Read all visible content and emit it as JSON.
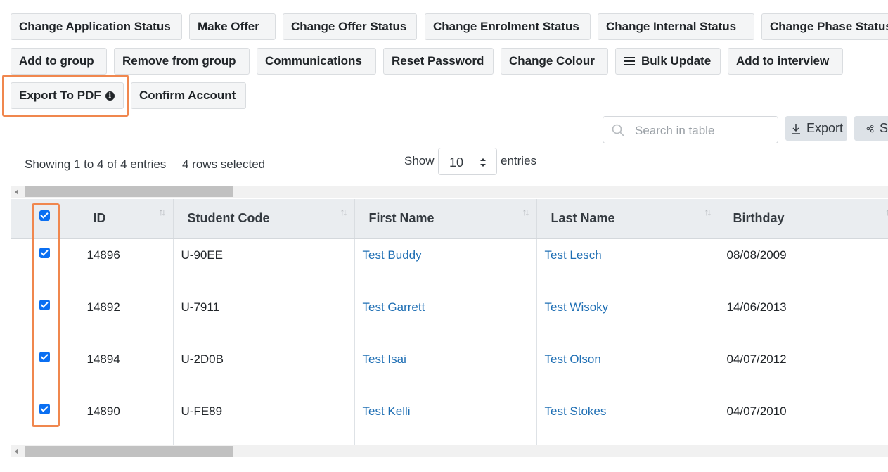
{
  "toolbar": {
    "row1": [
      "Change Application Status",
      "Make Offer",
      "Change Offer Status",
      "Change Enrolment Status",
      "Change Internal Status",
      "Change Phase Status"
    ],
    "row2": [
      "Add to group",
      "Remove from group",
      "Communications",
      "Reset Password",
      "Change Colour",
      "Bulk Update",
      "Add to interview"
    ],
    "row3": [
      "Export To PDF",
      "Confirm Account"
    ]
  },
  "table_tools": {
    "search_placeholder": "Search in table",
    "export_label": "Export",
    "share_label": "S"
  },
  "info": {
    "showing": "Showing 1 to 4 of 4 entries",
    "selected": "4 rows selected",
    "show_label": "Show",
    "page_size": "10",
    "entries_label": "entries"
  },
  "table": {
    "columns": [
      "ID",
      "Student Code",
      "First Name",
      "Last Name",
      "Birthday"
    ],
    "rows": [
      {
        "id": "14896",
        "code": "U-90EE",
        "first": "Test Buddy",
        "last": "Test Lesch",
        "birthday": "08/08/2009",
        "checked": true
      },
      {
        "id": "14892",
        "code": "U-7911",
        "first": "Test Garrett",
        "last": "Test Wisoky",
        "birthday": "14/06/2013",
        "checked": true
      },
      {
        "id": "14894",
        "code": "U-2D0B",
        "first": "Test Isai",
        "last": "Test Olson",
        "birthday": "04/07/2012",
        "checked": true
      },
      {
        "id": "14890",
        "code": "U-FE89",
        "first": "Test Kelli",
        "last": "Test Stokes",
        "birthday": "04/07/2010",
        "checked": true
      }
    ]
  },
  "colors": {
    "highlight": "#f0874e",
    "link": "#1f6fb4",
    "checkbox": "#0a6ff2"
  }
}
